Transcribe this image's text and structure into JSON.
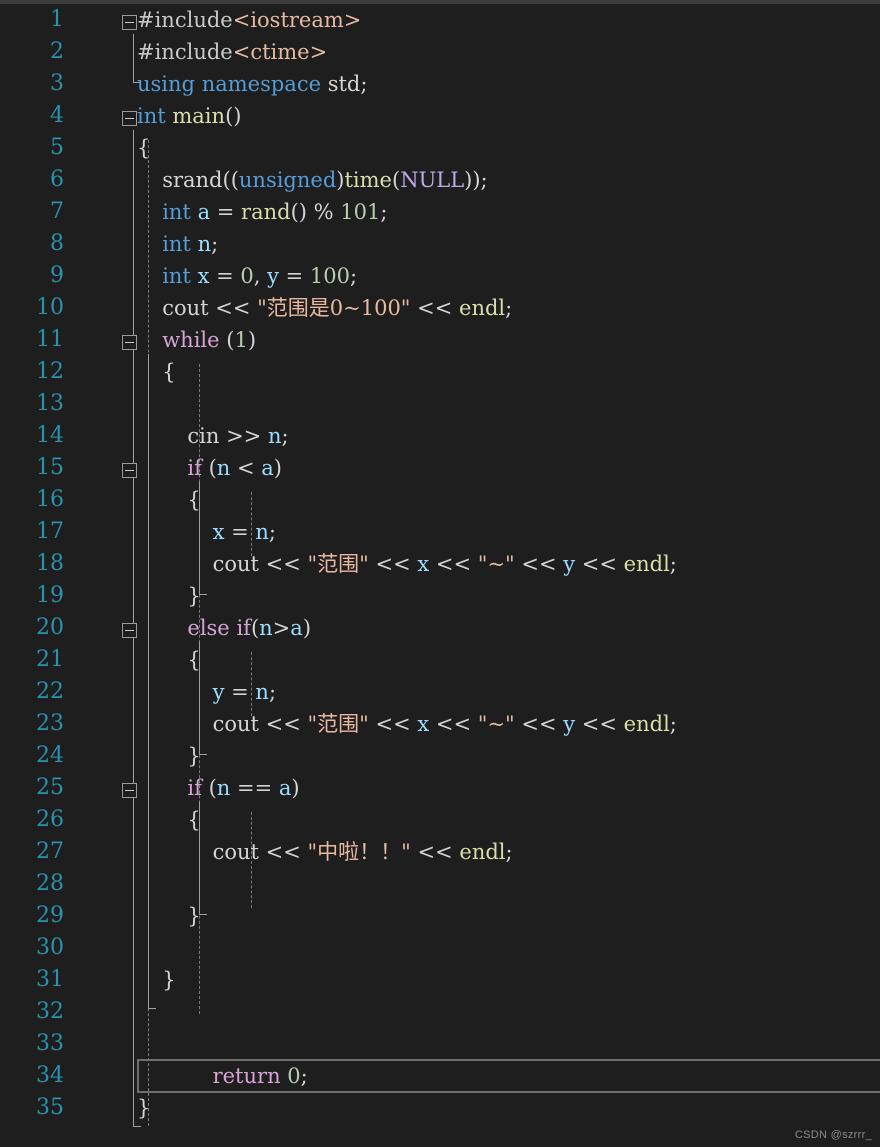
{
  "editor": {
    "language": "cpp",
    "background_color": "#1e1e1e",
    "line_number_color": "#2b91af",
    "current_line": 34,
    "total_lines": 35,
    "line_height_px": 32
  },
  "watermark": {
    "text": "CSDN @szrrr_"
  },
  "lines": [
    {
      "n": "1",
      "text": "#include<iostream>"
    },
    {
      "n": "2",
      "text": "#include<ctime>"
    },
    {
      "n": "3",
      "text": "using namespace std;"
    },
    {
      "n": "4",
      "text": "int main()"
    },
    {
      "n": "5",
      "text": "{"
    },
    {
      "n": "6",
      "text": "    srand((unsigned)time(NULL));"
    },
    {
      "n": "7",
      "text": "    int a = rand() % 101;"
    },
    {
      "n": "8",
      "text": "    int n;"
    },
    {
      "n": "9",
      "text": "    int x = 0, y = 100;"
    },
    {
      "n": "10",
      "text": "    cout << \"范围是0~100\" << endl;"
    },
    {
      "n": "11",
      "text": "    while (1)"
    },
    {
      "n": "12",
      "text": "    {"
    },
    {
      "n": "13",
      "text": ""
    },
    {
      "n": "14",
      "text": "        cin >> n;"
    },
    {
      "n": "15",
      "text": "        if (n < a)"
    },
    {
      "n": "16",
      "text": "        {"
    },
    {
      "n": "17",
      "text": "            x = n;"
    },
    {
      "n": "18",
      "text": "            cout << \"范围\" << x << \"~\" << y << endl;"
    },
    {
      "n": "19",
      "text": "        }"
    },
    {
      "n": "20",
      "text": "        else if(n>a)"
    },
    {
      "n": "21",
      "text": "        {"
    },
    {
      "n": "22",
      "text": "            y = n;"
    },
    {
      "n": "23",
      "text": "            cout << \"范围\" << x << \"~\" << y << endl;"
    },
    {
      "n": "24",
      "text": "        }"
    },
    {
      "n": "25",
      "text": "        if (n == a)"
    },
    {
      "n": "26",
      "text": "        {"
    },
    {
      "n": "27",
      "text": "            cout << \"中啦！！\" << endl;"
    },
    {
      "n": "28",
      "text": ""
    },
    {
      "n": "29",
      "text": "        }"
    },
    {
      "n": "30",
      "text": ""
    },
    {
      "n": "31",
      "text": "    }"
    },
    {
      "n": "32",
      "text": ""
    },
    {
      "n": "33",
      "text": ""
    },
    {
      "n": "34",
      "text": "        return 0;"
    },
    {
      "n": "35",
      "text": "}"
    }
  ],
  "tokens": {
    "l1": [
      [
        "#include",
        "pp"
      ],
      [
        "<iostream>",
        "str"
      ]
    ],
    "l2": [
      [
        "#include",
        "pp"
      ],
      [
        "<ctime>",
        "str"
      ]
    ],
    "l3": [
      [
        "using",
        "k"
      ],
      [
        " ",
        "op"
      ],
      [
        "namespace",
        "k"
      ],
      [
        " ",
        "op"
      ],
      [
        "std",
        "id"
      ],
      [
        ";",
        "op"
      ]
    ],
    "l4": [
      [
        "int",
        "k"
      ],
      [
        " ",
        "op"
      ],
      [
        "main",
        "fn"
      ],
      [
        "()",
        "op"
      ]
    ],
    "l5": [
      [
        "{",
        "br"
      ]
    ],
    "l6": [
      [
        "srand",
        "id"
      ],
      [
        "((",
        "op"
      ],
      [
        "unsigned",
        "k"
      ],
      [
        ")",
        "op"
      ],
      [
        "time",
        "fn"
      ],
      [
        "(",
        "op"
      ],
      [
        "NULL",
        "cst"
      ],
      [
        "));",
        "op"
      ]
    ],
    "l7": [
      [
        "int",
        "k"
      ],
      [
        " ",
        "op"
      ],
      [
        "a",
        "var"
      ],
      [
        " = ",
        "op"
      ],
      [
        "rand",
        "fn"
      ],
      [
        "() % ",
        "op"
      ],
      [
        "101",
        "num"
      ],
      [
        ";",
        "op"
      ]
    ],
    "l8": [
      [
        "int",
        "k"
      ],
      [
        " ",
        "op"
      ],
      [
        "n",
        "var"
      ],
      [
        ";",
        "op"
      ]
    ],
    "l9": [
      [
        "int",
        "k"
      ],
      [
        " ",
        "op"
      ],
      [
        "x",
        "var"
      ],
      [
        " = ",
        "op"
      ],
      [
        "0",
        "num"
      ],
      [
        ", ",
        "op"
      ],
      [
        "y",
        "var"
      ],
      [
        " = ",
        "op"
      ],
      [
        "100",
        "num"
      ],
      [
        ";",
        "op"
      ]
    ],
    "l10": [
      [
        "cout",
        "id"
      ],
      [
        " << ",
        "op"
      ],
      [
        "\"范围是0~100\"",
        "str"
      ],
      [
        " << ",
        "op"
      ],
      [
        "endl",
        "fn"
      ],
      [
        ";",
        "op"
      ]
    ],
    "l11": [
      [
        "while",
        "kw"
      ],
      [
        " (",
        "op"
      ],
      [
        "1",
        "num"
      ],
      [
        ")",
        "op"
      ]
    ],
    "l12": [
      [
        "{",
        "br"
      ]
    ],
    "l13": [
      [
        "",
        ""
      ]
    ],
    "l14": [
      [
        "cin",
        "id"
      ],
      [
        " >> ",
        "op"
      ],
      [
        "n",
        "var"
      ],
      [
        ";",
        "op"
      ]
    ],
    "l15": [
      [
        "if",
        "kw"
      ],
      [
        " (",
        "op"
      ],
      [
        "n",
        "var"
      ],
      [
        " < ",
        "op"
      ],
      [
        "a",
        "var"
      ],
      [
        ")",
        "op"
      ]
    ],
    "l16": [
      [
        "{",
        "br"
      ]
    ],
    "l17": [
      [
        "x",
        "var"
      ],
      [
        " = ",
        "op"
      ],
      [
        "n",
        "var"
      ],
      [
        ";",
        "op"
      ]
    ],
    "l18": [
      [
        "cout",
        "id"
      ],
      [
        " << ",
        "op"
      ],
      [
        "\"范围\"",
        "str"
      ],
      [
        " << ",
        "op"
      ],
      [
        "x",
        "var"
      ],
      [
        " << ",
        "op"
      ],
      [
        "\"~\"",
        "str"
      ],
      [
        " << ",
        "op"
      ],
      [
        "y",
        "var"
      ],
      [
        " << ",
        "op"
      ],
      [
        "endl",
        "fn"
      ],
      [
        ";",
        "op"
      ]
    ],
    "l19": [
      [
        "}",
        "br"
      ]
    ],
    "l20": [
      [
        "else",
        "kw"
      ],
      [
        " ",
        "op"
      ],
      [
        "if",
        "kw"
      ],
      [
        "(",
        "op"
      ],
      [
        "n",
        "var"
      ],
      [
        ">",
        "op"
      ],
      [
        "a",
        "var"
      ],
      [
        ")",
        "op"
      ]
    ],
    "l21": [
      [
        "{",
        "br"
      ]
    ],
    "l22": [
      [
        "y",
        "var"
      ],
      [
        " = ",
        "op"
      ],
      [
        "n",
        "var"
      ],
      [
        ";",
        "op"
      ]
    ],
    "l23": [
      [
        "cout",
        "id"
      ],
      [
        " << ",
        "op"
      ],
      [
        "\"范围\"",
        "str"
      ],
      [
        " << ",
        "op"
      ],
      [
        "x",
        "var"
      ],
      [
        " << ",
        "op"
      ],
      [
        "\"~\"",
        "str"
      ],
      [
        " << ",
        "op"
      ],
      [
        "y",
        "var"
      ],
      [
        " << ",
        "op"
      ],
      [
        "endl",
        "fn"
      ],
      [
        ";",
        "op"
      ]
    ],
    "l24": [
      [
        "}",
        "br"
      ]
    ],
    "l25": [
      [
        "if",
        "kw"
      ],
      [
        " (",
        "op"
      ],
      [
        "n",
        "var"
      ],
      [
        " == ",
        "op"
      ],
      [
        "a",
        "var"
      ],
      [
        ")",
        "op"
      ]
    ],
    "l26": [
      [
        "{",
        "br"
      ]
    ],
    "l27": [
      [
        "cout",
        "id"
      ],
      [
        " << ",
        "op"
      ],
      [
        "\"中啦！！\"",
        "str"
      ],
      [
        " << ",
        "op"
      ],
      [
        "endl",
        "fn"
      ],
      [
        ";",
        "op"
      ]
    ],
    "l28": [
      [
        "",
        ""
      ]
    ],
    "l29": [
      [
        "}",
        "br"
      ]
    ],
    "l30": [
      [
        "",
        ""
      ]
    ],
    "l31": [
      [
        "}",
        "br"
      ]
    ],
    "l32": [
      [
        "",
        ""
      ]
    ],
    "l33": [
      [
        "",
        ""
      ]
    ],
    "l34": [
      [
        "return",
        "kw"
      ],
      [
        " ",
        "op"
      ],
      [
        "0",
        "num"
      ],
      [
        ";",
        "op"
      ]
    ],
    "l35": [
      [
        "}",
        "br"
      ]
    ]
  },
  "indents": {
    "l1": 0,
    "l2": 0,
    "l3": 0,
    "l4": 0,
    "l5": 0,
    "l6": 2,
    "l7": 2,
    "l8": 2,
    "l9": 2,
    "l10": 2,
    "l11": 2,
    "l12": 2,
    "l13": 0,
    "l14": 4,
    "l15": 4,
    "l16": 4,
    "l17": 6,
    "l18": 6,
    "l19": 4,
    "l20": 4,
    "l21": 4,
    "l22": 6,
    "l23": 6,
    "l24": 4,
    "l25": 4,
    "l26": 4,
    "l27": 6,
    "l28": 0,
    "l29": 4,
    "l30": 0,
    "l31": 2,
    "l32": 0,
    "l33": 0,
    "l34": 6,
    "l35": 0
  },
  "fold_markers": [
    {
      "name": "fold-marker-line-1",
      "line": 1
    },
    {
      "name": "fold-marker-line-4",
      "line": 4
    },
    {
      "name": "fold-marker-line-11",
      "line": 11
    },
    {
      "name": "fold-marker-line-15",
      "line": 15
    },
    {
      "name": "fold-marker-line-20",
      "line": 20
    },
    {
      "name": "fold-marker-line-25",
      "line": 25
    }
  ]
}
